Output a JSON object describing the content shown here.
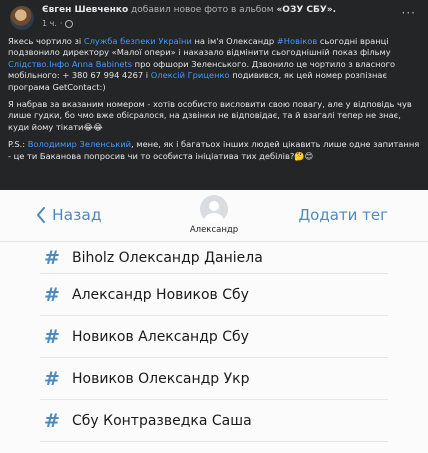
{
  "post": {
    "author": "Євген Шевченко",
    "action": "добавил новое фото в альбом",
    "album": "«ОЗУ СБУ».",
    "time": "1 ч.",
    "more": "···",
    "paragraph1": [
      {
        "t": "Якесь чортило зі ",
        "h": false
      },
      {
        "t": "Служба безпеки України",
        "h": true
      },
      {
        "t": " на ім'я Олександр ",
        "h": false
      },
      {
        "t": "#Новіков",
        "h": true
      },
      {
        "t": " сьогодні вранці подзвонило директору «Малої опери» і наказало відмінити сьогоднішній показ фільму ",
        "h": false
      },
      {
        "t": "Слідство.Інфо",
        "h": true
      },
      {
        "t": " ",
        "h": false
      },
      {
        "t": "Anna Babinets",
        "h": true
      },
      {
        "t": " про офшори Зеленського. Дзвонило це чортило з власного мобільного: + 380 67 994 4267 і ",
        "h": false
      },
      {
        "t": "Олексій Гриценко",
        "h": true
      },
      {
        "t": " подивився, як цей номер розпізнає програма GetContact:)",
        "h": false
      }
    ],
    "paragraph2": "Я набрав за вказаним номером - хотів особисто висловити свою повагу, але у відповідь чув лише гудки, бо чмо вже обісралося, на дзвінки не відповідає, та й взагалі тепер не знає, куди йому тікати😂😂",
    "paragraph3": [
      {
        "t": "P.S.: ",
        "h": false
      },
      {
        "t": "Володимир Зеленський",
        "h": true
      },
      {
        "t": ", мене, як і багатьох інших людей цікавить лише одне запитання - це ти Баканова попросив чи то особиста ініціатива тих дебілів?🤔😊",
        "h": false
      }
    ]
  },
  "contact": {
    "back_label": "Назад",
    "add_tag_label": "Додати тег",
    "name": "Александр",
    "hash_symbol": "#",
    "tags": [
      "Biholz Олександр Даніела",
      "Александр Новиков Сбу",
      "Новиков Александр Сбу",
      "Новиков Олександр Укр",
      "Сбу Контразведка Саша"
    ]
  }
}
